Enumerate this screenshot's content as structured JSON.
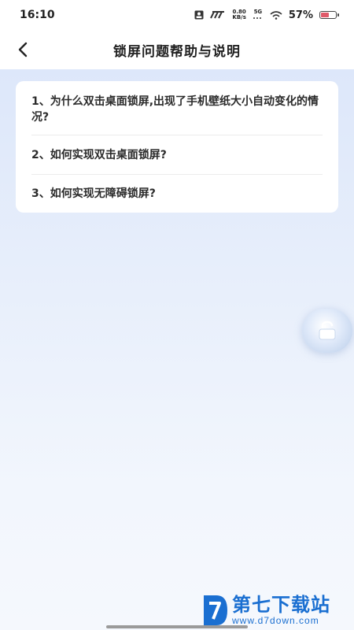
{
  "status_bar": {
    "time": "16:10",
    "net_speed_top": "0.80",
    "net_speed_bottom": "KB/s",
    "network": "5G",
    "battery_percent": "57%",
    "battery_level": 0.57
  },
  "header": {
    "title": "锁屏问题帮助与说明"
  },
  "faq": {
    "items": [
      {
        "label": "1、为什么双击桌面锁屏,出现了手机壁纸大小自动变化的情况?"
      },
      {
        "label": "2、如何实现双击桌面锁屏?"
      },
      {
        "label": "3、如何实现无障碍锁屏?"
      }
    ]
  },
  "watermark": {
    "title": "第七下载站",
    "url": "www.d7down.com"
  },
  "colors": {
    "accent": "#1a6fd1",
    "battery_fill": "#e05a6a"
  }
}
